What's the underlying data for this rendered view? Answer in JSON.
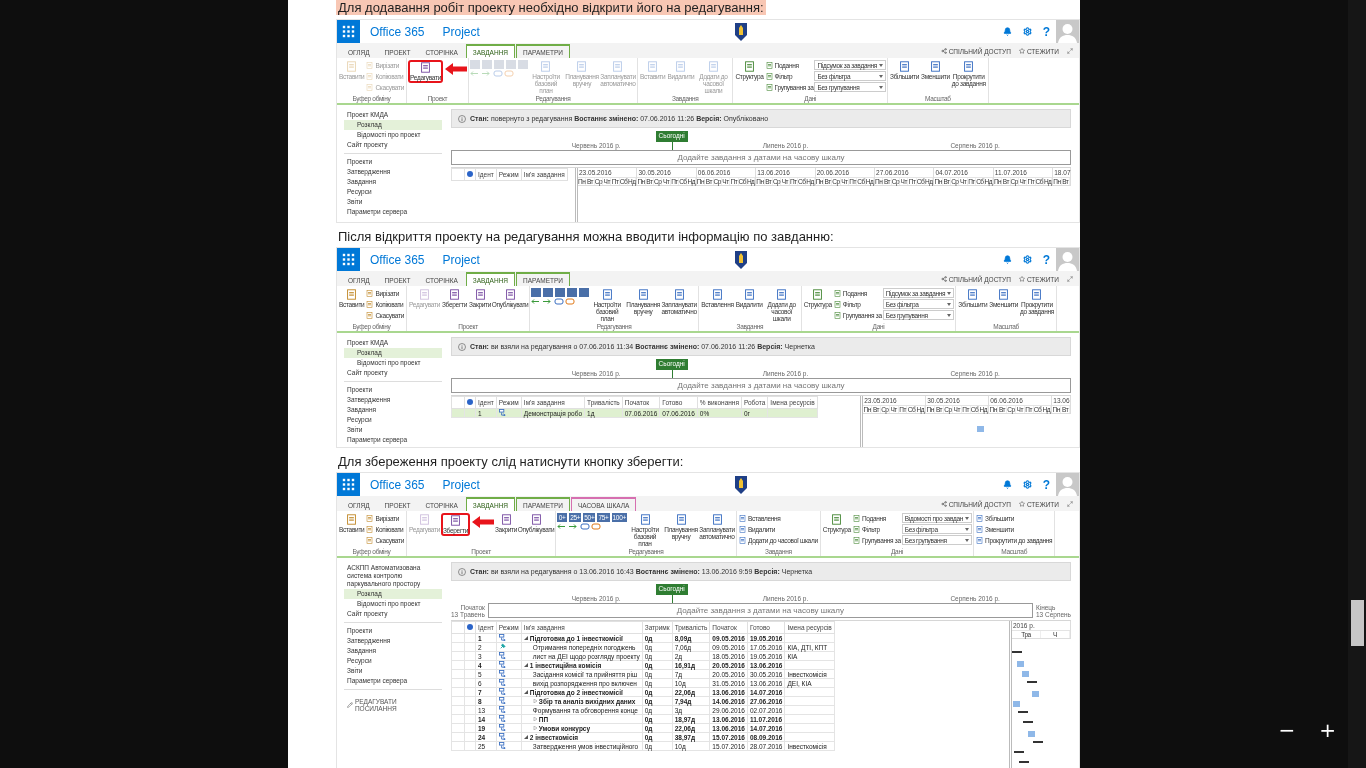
{
  "viewer": {
    "zoom_controls": [
      "−",
      "+"
    ]
  },
  "document": [
    {
      "kind": "paragraph",
      "text": "Для додавання робіт проекту необхідно відкрити його на редагування:",
      "highlighted": true
    },
    {
      "kind": "screenshot",
      "header": {
        "brand": "Office 365",
        "app": "Project",
        "help": "?"
      },
      "tabs": [
        {
          "label": "ОГЛЯД",
          "selected": false
        },
        {
          "label": "ПРОЕКТ",
          "selected": false
        },
        {
          "label": "СТОРІНКА",
          "selected": false
        },
        {
          "label": "ЗАВДАННЯ",
          "selected": true,
          "color": "#70ad47"
        },
        {
          "label": "ПАРАМЕТРИ",
          "selected": false,
          "color": "#70ad47"
        }
      ],
      "header_links": [
        "СПІЛЬНИЙ ДОСТУП",
        "СТЕЖИТИ"
      ],
      "ribbon": [
        {
          "label": "Буфер обміну",
          "items": [
            {
              "kind": "large",
              "label": "Вставити",
              "disabled": true,
              "highlighted": false
            },
            {
              "kind": "small",
              "label": "Вирізати",
              "disabled": true,
              "highlighted": false
            },
            {
              "kind": "small",
              "label": "Копіювати",
              "disabled": true,
              "highlighted": false
            },
            {
              "kind": "small",
              "label": "Скасувати",
              "disabled": true,
              "highlighted": false
            }
          ]
        },
        {
          "label": "Проект",
          "items": [
            {
              "kind": "large",
              "label": "Редагувати",
              "disabled": false,
              "highlighted": true
            }
          ]
        },
        {
          "label": "Редагування",
          "items": [
            {
              "kind": "toolset",
              "disabled": true
            },
            {
              "kind": "large",
              "label": "Настроїти базовий план",
              "disabled": true,
              "highlighted": false
            },
            {
              "kind": "large",
              "label": "Планування вручну",
              "disabled": true,
              "highlighted": false
            },
            {
              "kind": "large",
              "label": "Запланувати автоматично",
              "disabled": true,
              "highlighted": false
            }
          ]
        },
        {
          "label": "Завдання",
          "items": [
            {
              "kind": "large",
              "label": "Вставити",
              "disabled": true,
              "highlighted": false
            },
            {
              "kind": "large",
              "label": "Видалити",
              "disabled": true,
              "highlighted": false
            },
            {
              "kind": "large",
              "label": "Додати до часової шкали",
              "disabled": true,
              "highlighted": false
            }
          ]
        },
        {
          "label": "Дані",
          "items": [
            {
              "kind": "large",
              "label": "Структура",
              "disabled": false,
              "highlighted": false
            },
            {
              "kind": "small",
              "label": "Подання",
              "disabled": false,
              "highlighted": false
            },
            {
              "kind": "small",
              "label": "Фільтр",
              "disabled": false,
              "highlighted": false
            },
            {
              "kind": "small",
              "label": "Групування за",
              "disabled": false,
              "highlighted": false
            },
            {
              "kind": "select",
              "label": "Підсумок за завдання"
            },
            {
              "kind": "select",
              "label": "Без фільтра"
            },
            {
              "kind": "select",
              "label": "Без групування"
            }
          ]
        },
        {
          "label": "Масштаб",
          "items": [
            {
              "kind": "large",
              "label": "Збільшити",
              "disabled": false,
              "highlighted": false
            },
            {
              "kind": "large",
              "label": "Зменшити",
              "disabled": false,
              "highlighted": false
            },
            {
              "kind": "large",
              "label": "Прокрутити до завдання",
              "disabled": false,
              "highlighted": false
            }
          ]
        }
      ],
      "nav": [
        {
          "items": [
            {
              "label": "Проект КМДА",
              "selected": false,
              "children": [
                {
                  "label": "Розклад",
                  "selected": true
                },
                {
                  "label": "Відомості про проект",
                  "selected": false
                }
              ]
            },
            {
              "label": "Сайт проекту",
              "selected": false
            }
          ]
        },
        {
          "items": [
            {
              "label": "Проекти",
              "selected": false
            },
            {
              "label": "Затвердження",
              "selected": false
            },
            {
              "label": "Завдання",
              "selected": false
            },
            {
              "label": "Ресурси",
              "selected": false
            },
            {
              "label": "Звіти",
              "selected": false
            },
            {
              "label": "Параметри сервера",
              "selected": false
            }
          ]
        }
      ],
      "status": "**Стан:** повернуто з редагування **Востаннє змінено:** 07.06.2016 11:26 **Версія:** Опубліковано",
      "timeline": {
        "today": "Сьогодні",
        "months": [
          "Червень 2016 р.",
          "Липень 2016 р.",
          "Серпень 2016 р."
        ],
        "prompt": "Додайте завдання з датами на часову шкалу"
      },
      "table": {
        "columns": [
          "Ідент",
          "Режим",
          "Ім'я завдання"
        ]
      },
      "gantt": {
        "periods": [
          {
            "label": "23.05.2016",
            "days": [
              "Пн",
              "Вт",
              "Ср",
              "Чт",
              "Пт",
              "Сб",
              "Нд"
            ]
          },
          {
            "label": "30.05.2016",
            "days": [
              "Пн",
              "Вт",
              "Ср",
              "Чт",
              "Пт",
              "Сб",
              "Нд"
            ]
          },
          {
            "label": "06.06.2016",
            "days": [
              "Пн",
              "Вт",
              "Ср",
              "Чт",
              "Пт",
              "Сб",
              "Нд"
            ]
          },
          {
            "label": "13.06.2016",
            "days": [
              "Пн",
              "Вт",
              "Ср",
              "Чт",
              "Пт",
              "Сб",
              "Нд"
            ]
          },
          {
            "label": "20.06.2016",
            "days": [
              "Пн",
              "Вт",
              "Ср",
              "Чт",
              "Пт",
              "Сб",
              "Нд"
            ]
          },
          {
            "label": "27.06.2016",
            "days": [
              "Пн",
              "Вт",
              "Ср",
              "Чт",
              "Пт",
              "Сб",
              "Нд"
            ]
          },
          {
            "label": "04.07.2016",
            "days": [
              "Пн",
              "Вт",
              "Ср",
              "Чт",
              "Пт",
              "Сб",
              "Нд"
            ]
          },
          {
            "label": "11.07.2016",
            "days": [
              "Пн",
              "Вт",
              "Ср",
              "Чт",
              "Пт",
              "Сб",
              "Нд"
            ]
          },
          {
            "label": "18.07",
            "days": [
              "Пн",
              "Вт"
            ]
          }
        ]
      }
    },
    {
      "kind": "paragraph",
      "text": "Після відкриття проекту на редагування можна вводити інформацію по завданню:",
      "highlighted": false
    },
    {
      "kind": "screenshot",
      "header": {
        "brand": "Office 365",
        "app": "Project",
        "help": "?"
      },
      "tabs": [
        {
          "label": "ОГЛЯД",
          "selected": false
        },
        {
          "label": "ПРОЕКТ",
          "selected": false
        },
        {
          "label": "СТОРІНКА",
          "selected": false
        },
        {
          "label": "ЗАВДАННЯ",
          "selected": true,
          "color": "#70ad47"
        },
        {
          "label": "ПАРАМЕТРИ",
          "selected": false,
          "color": "#70ad47"
        }
      ],
      "header_links": [
        "СПІЛЬНИЙ ДОСТУП",
        "СТЕЖИТИ"
      ],
      "ribbon": [
        {
          "label": "Буфер обміну",
          "items": [
            {
              "kind": "large",
              "label": "Вставити",
              "disabled": false,
              "highlighted": false
            },
            {
              "kind": "small",
              "label": "Вирізати",
              "disabled": false,
              "highlighted": false
            },
            {
              "kind": "small",
              "label": "Копіювати",
              "disabled": false,
              "highlighted": false
            },
            {
              "kind": "small",
              "label": "Скасувати",
              "disabled": false,
              "highlighted": false
            }
          ]
        },
        {
          "label": "Проект",
          "items": [
            {
              "kind": "large",
              "label": "Редагувати",
              "disabled": true,
              "highlighted": false
            },
            {
              "kind": "large",
              "label": "Зберегти",
              "disabled": false,
              "highlighted": false
            },
            {
              "kind": "large",
              "label": "Закрити",
              "disabled": false,
              "highlighted": false
            },
            {
              "kind": "large",
              "label": "Опублікувати",
              "disabled": false,
              "highlighted": false
            }
          ]
        },
        {
          "label": "Редагування",
          "items": [
            {
              "kind": "toolset",
              "disabled": false
            },
            {
              "kind": "large",
              "label": "Настроїти базовий план",
              "disabled": false,
              "highlighted": false
            },
            {
              "kind": "large",
              "label": "Планування вручну",
              "disabled": false,
              "highlighted": false
            },
            {
              "kind": "large",
              "label": "Запланувати автоматично",
              "disabled": false,
              "highlighted": false
            }
          ]
        },
        {
          "label": "Завдання",
          "items": [
            {
              "kind": "large",
              "label": "Вставлення",
              "disabled": false,
              "highlighted": false
            },
            {
              "kind": "large",
              "label": "Видалити",
              "disabled": false,
              "highlighted": false
            },
            {
              "kind": "large",
              "label": "Додати до часової шкали",
              "disabled": false,
              "highlighted": false
            }
          ]
        },
        {
          "label": "Дані",
          "items": [
            {
              "kind": "large",
              "label": "Структура",
              "disabled": false,
              "highlighted": false
            },
            {
              "kind": "small",
              "label": "Подання",
              "disabled": false,
              "highlighted": false
            },
            {
              "kind": "small",
              "label": "Фільтр",
              "disabled": false,
              "highlighted": false
            },
            {
              "kind": "small",
              "label": "Групування за",
              "disabled": false,
              "highlighted": false
            },
            {
              "kind": "select",
              "label": "Підсумок за завдання"
            },
            {
              "kind": "select",
              "label": "Без фільтра"
            },
            {
              "kind": "select",
              "label": "Без групування"
            }
          ]
        },
        {
          "label": "Масштаб",
          "items": [
            {
              "kind": "large",
              "label": "Збільшити",
              "disabled": false,
              "highlighted": false
            },
            {
              "kind": "large",
              "label": "Зменшити",
              "disabled": false,
              "highlighted": false
            },
            {
              "kind": "large",
              "label": "Прокрутити до завдання",
              "disabled": false,
              "highlighted": false
            }
          ]
        }
      ],
      "nav": [
        {
          "items": [
            {
              "label": "Проект КМДА",
              "selected": false,
              "children": [
                {
                  "label": "Розклад",
                  "selected": true
                },
                {
                  "label": "Відомості про проект",
                  "selected": false
                }
              ]
            },
            {
              "label": "Сайт проекту",
              "selected": false
            }
          ]
        },
        {
          "items": [
            {
              "label": "Проекти",
              "selected": false
            },
            {
              "label": "Затвердження",
              "selected": false
            },
            {
              "label": "Завдання",
              "selected": false
            },
            {
              "label": "Ресурси",
              "selected": false
            },
            {
              "label": "Звіти",
              "selected": false
            },
            {
              "label": "Параметри сервера",
              "selected": false
            }
          ]
        }
      ],
      "status": "**Стан:** ви взяли на редагування о 07.06.2016 11:34 **Востаннє змінено:** 07.06.2016 11:26 **Версія:** Чернетка",
      "timeline": {
        "today": "Сьогодні",
        "months": [
          "Червень 2016 р.",
          "Липень 2016 р.",
          "Серпень 2016 р."
        ],
        "prompt": "Додайте завдання з датами на часову шкалу"
      },
      "table": {
        "columns": [
          "Ідент",
          "Режим",
          "Ім'я завдання",
          "Тривалість",
          "Початок",
          "Готово",
          "% виконання",
          "Робота",
          "Імена ресурсів"
        ],
        "rows": [
          {
            "id": "1",
            "kind": "auto",
            "name": "Демонстрація робо",
            "summary": false,
            "selected": true,
            "values": [
              "1д",
              "07.06.2016",
              "07.06.2016",
              "0%",
              "0г"
            ]
          }
        ]
      },
      "gantt": {
        "periods": [
          {
            "label": "23.05.2016",
            "days": [
              "Пн",
              "Вт",
              "Ср",
              "Чт",
              "Пт",
              "Сб",
              "Нд"
            ]
          },
          {
            "label": "30.05.2016",
            "days": [
              "Пн",
              "Вт",
              "Ср",
              "Чт",
              "Пт",
              "Сб",
              "Нд"
            ]
          },
          {
            "label": "06.06.2016",
            "days": [
              "Пн",
              "Вт",
              "Ср",
              "Чт",
              "Пт",
              "Сб",
              "Нд"
            ]
          },
          {
            "label": "13.06",
            "days": [
              "Пн",
              "Вт"
            ]
          }
        ]
      }
    },
    {
      "kind": "paragraph",
      "text": "Для збереження проекту слід натиснути кнопку зберегти:",
      "highlighted": false
    },
    {
      "kind": "screenshot",
      "header": {
        "brand": "Office 365",
        "app": "Project",
        "help": "?"
      },
      "tabs": [
        {
          "label": "ОГЛЯД",
          "selected": false
        },
        {
          "label": "ПРОЕКТ",
          "selected": false
        },
        {
          "label": "СТОРІНКА",
          "selected": false
        },
        {
          "label": "ЗАВДАННЯ",
          "selected": true,
          "color": "#70ad47"
        },
        {
          "label": "ПАРАМЕТРИ",
          "selected": false,
          "color": "#70ad47"
        },
        {
          "label": "ЧАСОВА ШКАЛА",
          "selected": false,
          "color": "#d66fb0"
        }
      ],
      "header_links": [
        "СПІЛЬНИЙ ДОСТУП",
        "СТЕЖИТИ"
      ],
      "ribbon": [
        {
          "label": "Буфер обміну",
          "items": [
            {
              "kind": "large",
              "label": "Вставити",
              "disabled": false,
              "highlighted": false
            },
            {
              "kind": "small",
              "label": "Вирізати",
              "disabled": false,
              "highlighted": false
            },
            {
              "kind": "small",
              "label": "Копіювати",
              "disabled": false,
              "highlighted": false
            },
            {
              "kind": "small",
              "label": "Скасувати",
              "disabled": false,
              "highlighted": false
            }
          ]
        },
        {
          "label": "Проект",
          "items": [
            {
              "kind": "large",
              "label": "Редагувати",
              "disabled": true,
              "highlighted": false
            },
            {
              "kind": "large",
              "label": "Зберегти",
              "disabled": false,
              "highlighted": true
            },
            {
              "kind": "large",
              "label": "Закрити",
              "disabled": false,
              "highlighted": false
            },
            {
              "kind": "large",
              "label": "Опублікувати",
              "disabled": false,
              "highlighted": false
            }
          ]
        },
        {
          "label": "Редагування",
          "items": [
            {
              "kind": "toolset",
              "labels": [
                "0+",
                "25+",
                "50+",
                "75+",
                "100+"
              ],
              "disabled": false
            },
            {
              "kind": "large",
              "label": "Настроїти базовий план",
              "disabled": false,
              "highlighted": false
            },
            {
              "kind": "large",
              "label": "Планування вручну",
              "disabled": false,
              "highlighted": false
            },
            {
              "kind": "large",
              "label": "Запланувати автоматично",
              "disabled": false,
              "highlighted": false
            }
          ]
        },
        {
          "label": "Завдання",
          "items": [
            {
              "kind": "small",
              "label": "Вставлення",
              "disabled": false,
              "highlighted": false
            },
            {
              "kind": "small",
              "label": "Видалити",
              "disabled": false,
              "highlighted": false
            },
            {
              "kind": "small",
              "label": "Додати до часової шкали",
              "disabled": false,
              "highlighted": false
            }
          ]
        },
        {
          "label": "Дані",
          "items": [
            {
              "kind": "large",
              "label": "Структура",
              "disabled": false,
              "highlighted": false
            },
            {
              "kind": "small",
              "label": "Подання",
              "disabled": false,
              "highlighted": false
            },
            {
              "kind": "small",
              "label": "Фільтр",
              "disabled": false,
              "highlighted": false
            },
            {
              "kind": "small",
              "label": "Групування за",
              "disabled": false,
              "highlighted": false
            },
            {
              "kind": "select",
              "label": "Відомості про завдан"
            },
            {
              "kind": "select",
              "label": "Без фільтра"
            },
            {
              "kind": "select",
              "label": "Без групування"
            }
          ]
        },
        {
          "label": "Масштаб",
          "items": [
            {
              "kind": "small",
              "label": "Збільшити",
              "disabled": false,
              "highlighted": false
            },
            {
              "kind": "small",
              "label": "Зменшити",
              "disabled": false,
              "highlighted": false
            },
            {
              "kind": "small",
              "label": "Прокрутити до завдання",
              "disabled": false,
              "highlighted": false
            }
          ]
        }
      ],
      "nav": [
        {
          "items": [
            {
              "label": "АСКПП Автоматизована система контролю паркувального простору",
              "selected": false,
              "children": [
                {
                  "label": "Розклад",
                  "selected": true
                },
                {
                  "label": "Відомості про проект",
                  "selected": false
                }
              ]
            },
            {
              "label": "Сайт проекту",
              "selected": false
            }
          ]
        },
        {
          "items": [
            {
              "label": "Проекти",
              "selected": false
            },
            {
              "label": "Затвердження",
              "selected": false
            },
            {
              "label": "Завдання",
              "selected": false
            },
            {
              "label": "Ресурси",
              "selected": false
            },
            {
              "label": "Звіти",
              "selected": false
            },
            {
              "label": "Параметри сервера",
              "selected": false
            }
          ]
        }
      ],
      "edit_link": "РЕДАГУВАТИ ПОСИЛАННЯ",
      "status": "**Стан:** ви взяли на редагування о 13.06.2016 16:43 **Востаннє змінено:** 13.06.2016 9:59 **Версія:** Чернетка",
      "timeline": {
        "today": "Сьогодні",
        "months": [
          "Червень 2016 р.",
          "Липень 2016 р.",
          "Серпень 2016 р."
        ],
        "prompt": "Додайте завдання з датами на часову шкалу",
        "start": [
          "Початок",
          "13 Травень"
        ],
        "finish": [
          "Кінець",
          "13 Серпень"
        ]
      },
      "table": {
        "columns": [
          "Ідент",
          "Режим",
          "Ім'я завдання",
          "Затримк",
          "Тривалість",
          "Початок",
          "Готово",
          "Імена ресурсів"
        ],
        "rows": [
          {
            "id": "1",
            "kind": "auto",
            "name": "Підготовка до 1 інвесткомісії",
            "summary": true,
            "expanded": true,
            "selected": false,
            "values": [
              "0д",
              "8,09д",
              "09.05.2016",
              "19.05.2016"
            ],
            "children": [
              {
                "id": "2",
                "kind": "manual",
                "name": "Отримання попередніх погоджень",
                "summary": false,
                "selected": false,
                "values": [
                  "0д",
                  "7,06д",
                  "09.05.2016",
                  "17.05.2016",
                  "КІА, ДТІ, КПТ"
                ]
              },
              {
                "id": "3",
                "kind": "auto",
                "name": "лист на ДЕІ щодо розгляду проекту",
                "summary": false,
                "selected": false,
                "values": [
                  "0д",
                  "2д",
                  "18.05.2016",
                  "19.05.2016",
                  "КІА"
                ]
              }
            ]
          },
          {
            "id": "4",
            "kind": "auto",
            "name": "1 інвестиційна комісія",
            "summary": true,
            "expanded": true,
            "selected": false,
            "values": [
              "0д",
              "16,91д",
              "20.05.2016",
              "13.06.2016"
            ],
            "children": [
              {
                "id": "5",
                "kind": "auto",
                "name": "Засідання комісії та прийняття ріш",
                "summary": false,
                "selected": false,
                "values": [
                  "0д",
                  "7д",
                  "20.05.2016",
                  "30.05.2016",
                  "Інвесткомісія"
                ]
              },
              {
                "id": "6",
                "kind": "auto",
                "name": "вихід розпорядження про включен",
                "summary": false,
                "selected": false,
                "values": [
                  "0д",
                  "10д",
                  "31.05.2016",
                  "13.06.2016",
                  "ДЕІ, КІА"
                ]
              }
            ]
          },
          {
            "id": "7",
            "kind": "auto",
            "name": "Підготовка до 2 інвесткомісії",
            "summary": true,
            "expanded": true,
            "selected": false,
            "values": [
              "0д",
              "22,06д",
              "13.06.2016",
              "14.07.2016"
            ],
            "children": [
              {
                "id": "8",
                "kind": "auto",
                "name": "Збір та аналіз вихідних даних",
                "summary": true,
                "expanded": false,
                "selected": false,
                "values": [
                  "0д",
                  "7,94д",
                  "14.06.2016",
                  "27.06.2016"
                ]
              },
              {
                "id": "13",
                "kind": "auto",
                "name": "Формування та обговорення конце",
                "summary": false,
                "selected": false,
                "values": [
                  "0д",
                  "3д",
                  "29.06.2016",
                  "02.07.2016"
                ]
              },
              {
                "id": "14",
                "kind": "auto",
                "name": "ПП",
                "summary": true,
                "expanded": false,
                "selected": false,
                "values": [
                  "0д",
                  "18,97д",
                  "13.06.2016",
                  "11.07.2016"
                ]
              },
              {
                "id": "19",
                "kind": "auto",
                "name": "Умови конкурсу",
                "summary": true,
                "expanded": false,
                "selected": false,
                "values": [
                  "0д",
                  "22,06д",
                  "13.06.2016",
                  "14.07.2016"
                ]
              }
            ]
          },
          {
            "id": "24",
            "kind": "auto",
            "name": "2 інвесткомісія",
            "summary": true,
            "expanded": true,
            "selected": false,
            "values": [
              "0д",
              "38,97д",
              "15.07.2016",
              "08.09.2016"
            ],
            "children": [
              {
                "id": "25",
                "kind": "auto",
                "name": "Затвердження умов інвестиційного",
                "summary": false,
                "selected": false,
                "values": [
                  "0д",
                  "10д",
                  "15.07.2016",
                  "28.07.2016",
                  "Інвесткомісія"
                ]
              }
            ]
          }
        ]
      },
      "gantt": {
        "periods": [
          {
            "label": "2016 р.",
            "days": [
              "Тра",
              "Ч"
            ]
          }
        ]
      }
    }
  ]
}
